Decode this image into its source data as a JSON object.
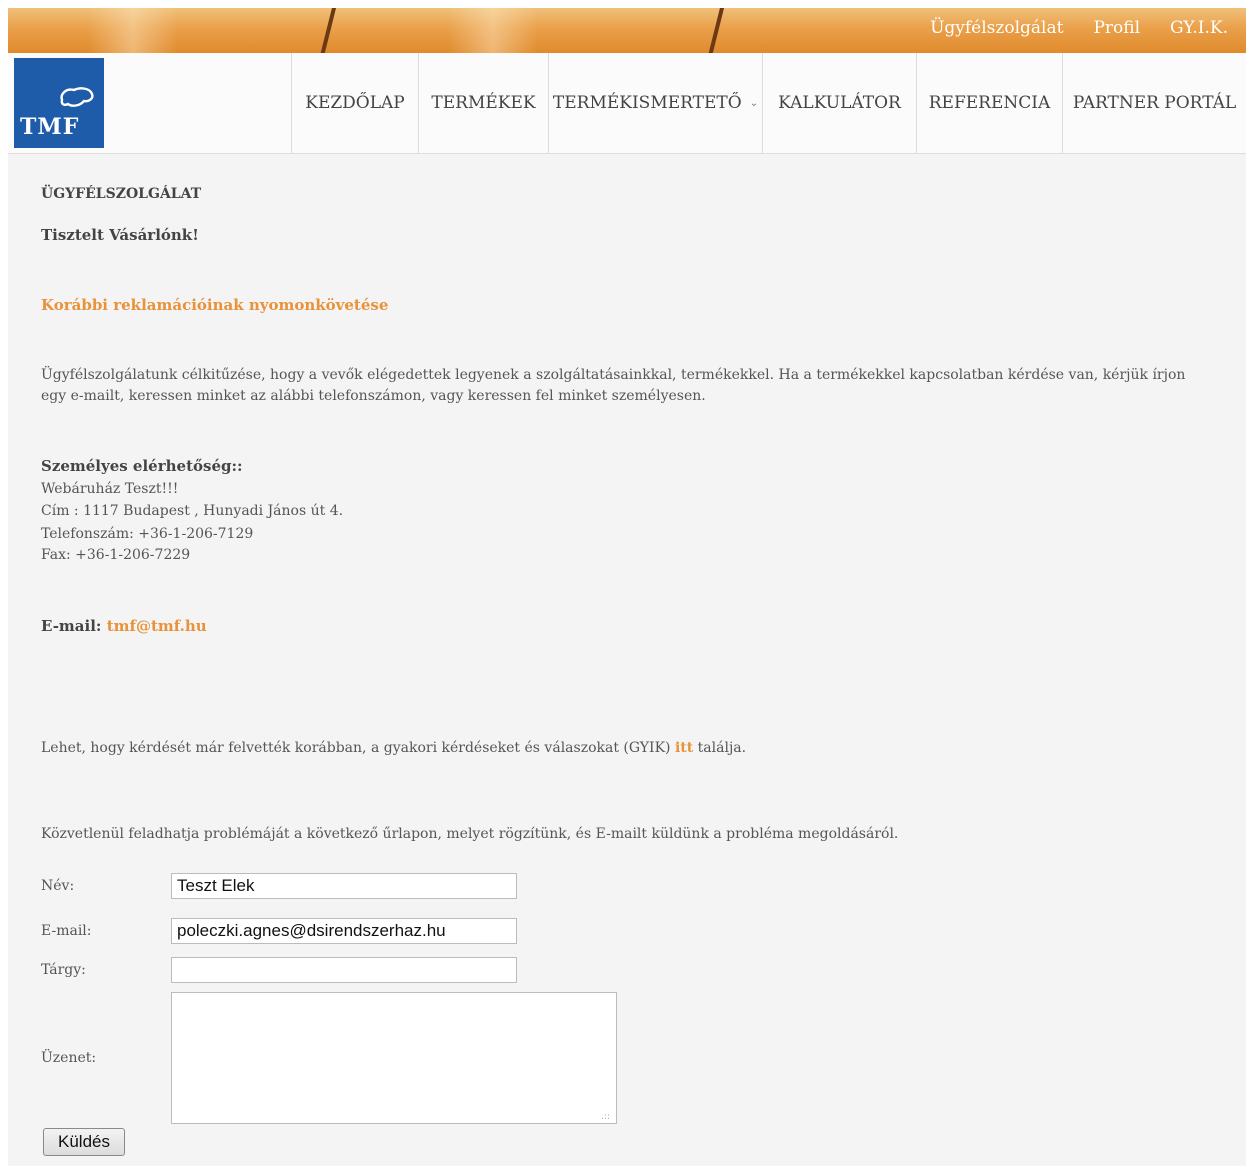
{
  "topbar": {
    "links": [
      "Ügyfélszolgálat",
      "Profil",
      "GY.I.K."
    ]
  },
  "logo": {
    "text": "TMF"
  },
  "nav": {
    "items": [
      {
        "label": "KEZDŐLAP"
      },
      {
        "label": "TERMÉKEK"
      },
      {
        "label": "TERMÉKISMERTETŐ",
        "has_dropdown": true
      },
      {
        "label": "KALKULÁTOR"
      },
      {
        "label": "REFERENCIA"
      },
      {
        "label": "PARTNER PORTÁL"
      }
    ]
  },
  "page": {
    "title": "ÜGYFÉLSZOLGÁLAT",
    "greeting": "Tisztelt Vásárlónk!",
    "track_link": "Korábbi reklamációinak nyomonkövetése",
    "intro": "Ügyfélszolgálatunk célkitűzése, hogy a vevők elégedettek legyenek a szolgáltatásainkkal, termékekkel. Ha a termékekkel kapcsolatban kérdése van, kérjük írjon egy e-mailt, keressen minket az alábbi telefonszámon, vagy keressen fel minket személyesen.",
    "contact_heading": "Személyes elérhetőség::",
    "contact_lines": [
      "Webáruház Teszt!!!",
      "Cím : 1117 Budapest , Hunyadi János út 4.",
      "Telefonszám: +36-1-206-7129",
      "Fax: +36-1-206-7229"
    ],
    "email_label": "E-mail:",
    "email_value": "tmf@tmf.hu",
    "faq_before": "Lehet, hogy kérdését már felvették korábban, a gyakori kérdéseket és válaszokat (GYIK) ",
    "faq_link": "itt",
    "faq_after": " találja.",
    "form_intro": "Közvetlenül feladhatja problémáját a következő űrlapon, melyet rögzítünk, és E-mailt küldünk a probléma megoldásáról."
  },
  "form": {
    "name_label": "Név:",
    "name_value": "Teszt Elek",
    "email_label": "E-mail:",
    "email_value": "poleczki.agnes@dsirendszerhaz.hu",
    "subject_label": "Tárgy:",
    "subject_value": "",
    "message_label": "Üzenet:",
    "message_value": "",
    "submit_label": "Küldés"
  },
  "colors": {
    "accent": "#e8923a",
    "logo_blue": "#1e5ba8",
    "topbar": "#e8993e"
  }
}
